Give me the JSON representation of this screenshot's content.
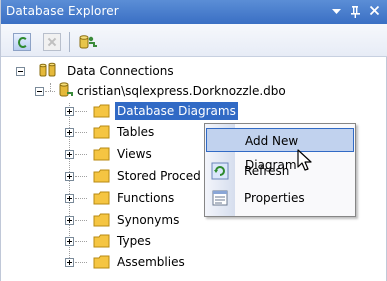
{
  "window": {
    "title": "Database Explorer",
    "dropdown_glyph": "▾",
    "pin_glyph": "ᚿ",
    "close_glyph": "✕"
  },
  "toolbar": {
    "refresh_icon": "refresh-icon",
    "stop_icon": "stop-refresh-icon",
    "connect_icon": "connect-to-database-icon"
  },
  "tree": {
    "root_label": "Data Connections",
    "connection_label": "cristian\\sqlexpress.Dorknozzle.dbo",
    "items": [
      {
        "label": "Database Diagrams",
        "selected": true
      },
      {
        "label": "Tables"
      },
      {
        "label": "Views"
      },
      {
        "label": "Stored Procedures",
        "visible_text": "Stored Proced"
      },
      {
        "label": "Functions"
      },
      {
        "label": "Synonyms"
      },
      {
        "label": "Types"
      },
      {
        "label": "Assemblies"
      }
    ]
  },
  "context_menu": {
    "items": [
      {
        "label": "Add New Diagram",
        "highlighted": true
      },
      {
        "label": "Refresh",
        "icon": "refresh-icon"
      },
      {
        "label": "Properties",
        "icon": "properties-icon"
      }
    ]
  },
  "colors": {
    "title_bar": "#3a6fc4",
    "selection": "#316ac5",
    "menu_hover": "#c1d2ee",
    "folder": "#f5c542"
  }
}
